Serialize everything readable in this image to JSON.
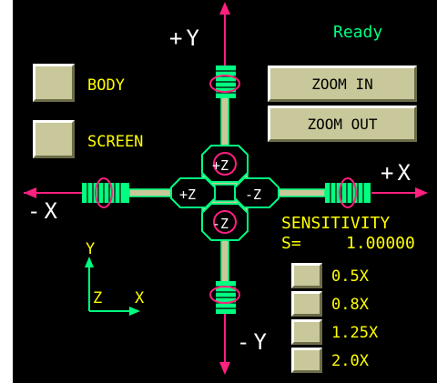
{
  "status": "Ready",
  "view_toggles": [
    {
      "label": "BODY"
    },
    {
      "label": "SCREEN"
    }
  ],
  "zoom": {
    "in_label": "ZOOM IN",
    "out_label": "ZOOM OUT"
  },
  "axis_labels": {
    "plus_y": "+Y",
    "minus_y": "-Y",
    "plus_x": "+X",
    "minus_x": "-X",
    "center_top": "+Z",
    "center_left": "+Z",
    "center_right": "-Z",
    "center_bottom": "-Z"
  },
  "sensitivity": {
    "title": "SENSITIVITY",
    "prefix": "S=",
    "value": "1.00000",
    "options": [
      {
        "label": "0.5X"
      },
      {
        "label": "0.8X"
      },
      {
        "label": "1.25X"
      },
      {
        "label": "2.0X"
      }
    ]
  },
  "triad": {
    "y": "Y",
    "z": "Z",
    "x": "X"
  },
  "colors": {
    "background": "#000000",
    "status_green": "#00ff80",
    "label_yellow": "#ffff00",
    "arrow_pink": "#ff2080",
    "outline_green": "#00ff80",
    "button_face": "#c8c89a"
  }
}
